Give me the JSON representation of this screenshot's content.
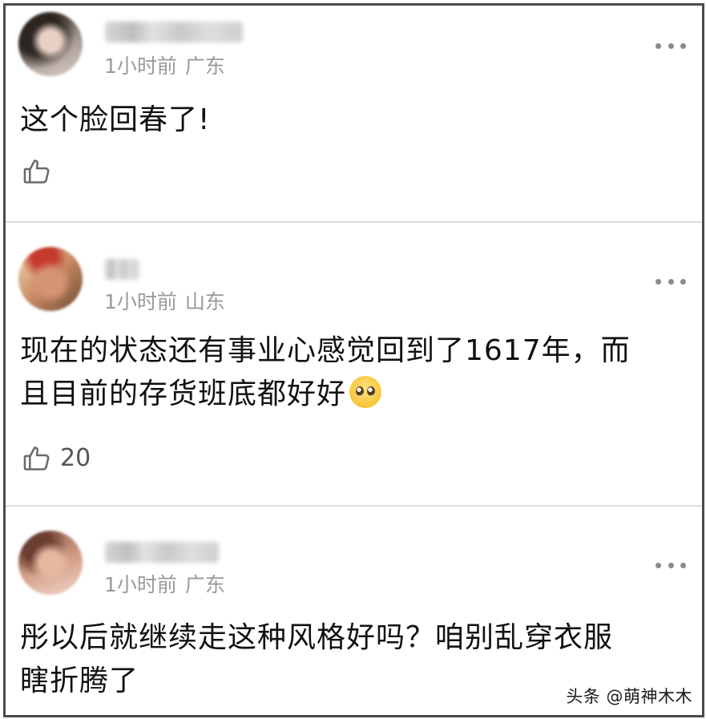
{
  "comments": [
    {
      "time": "1小时前",
      "location": "广东",
      "text": "这个脸回春了!",
      "likes": ""
    },
    {
      "time": "1小时前",
      "location": "山东",
      "text_line1": "现在的状态还有事业心感觉回到了1617年，而",
      "text_line2": "且目前的存货班底都好好",
      "emoji": "pleading-face-emoji",
      "likes": "20"
    },
    {
      "time": "1小时前",
      "location": "广东",
      "text_line1": "彤以后就继续走这种风格好吗？咱别乱穿衣服",
      "text_line2": "瞎折腾了"
    }
  ],
  "icons": {
    "like": "thumbs-up-icon",
    "more": "more-dots-icon"
  },
  "watermark": "头条 @萌神木木",
  "colors": {
    "meta_text": "#9a9a9a",
    "body_text": "#111111",
    "icon": "#6a6a6a",
    "divider": "#dcdcdc",
    "frame": "#4a4a4a"
  }
}
